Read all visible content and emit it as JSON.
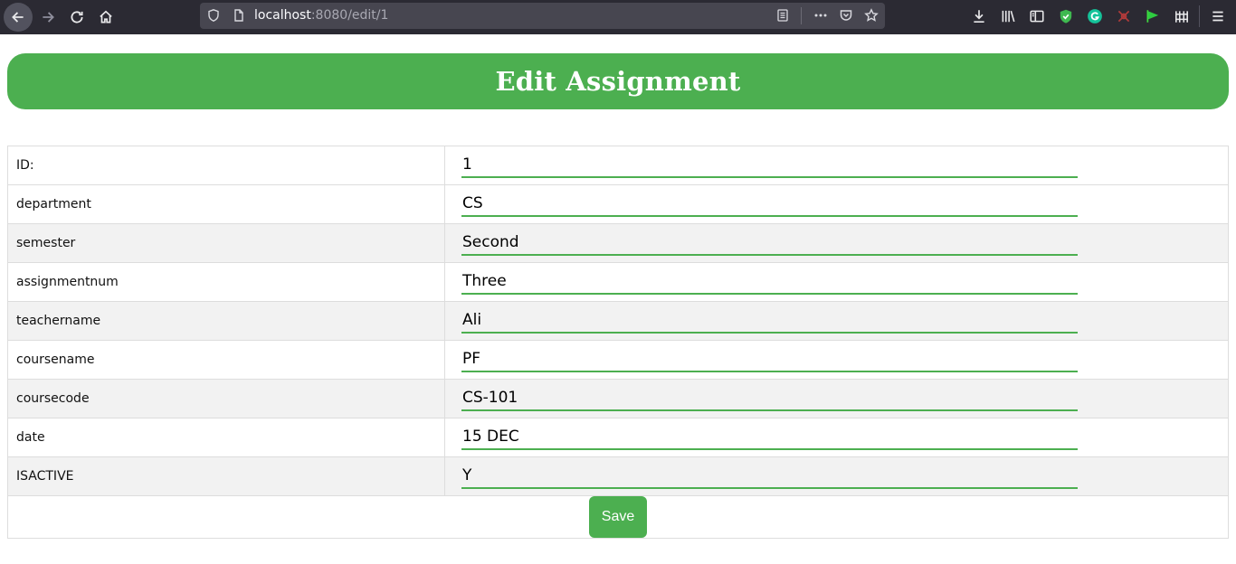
{
  "browser": {
    "url_host": "localhost",
    "url_rest": ":8080/edit/1"
  },
  "page": {
    "title": "Edit Assignment"
  },
  "form": {
    "rows": [
      {
        "label": "ID:",
        "value": "1"
      },
      {
        "label": "department",
        "value": "CS"
      },
      {
        "label": "semester",
        "value": "Second"
      },
      {
        "label": "assignmentnum",
        "value": "Three"
      },
      {
        "label": "teachername",
        "value": "Ali"
      },
      {
        "label": "coursename",
        "value": "PF"
      },
      {
        "label": "coursecode",
        "value": "CS-101"
      },
      {
        "label": "date",
        "value": "15 DEC"
      },
      {
        "label": "ISACTIVE",
        "value": "Y"
      }
    ],
    "save_label": "Save"
  },
  "colors": {
    "accent": "#4caf50",
    "toolbar": "#2b2a33",
    "row_alt": "#f2f2f2"
  }
}
